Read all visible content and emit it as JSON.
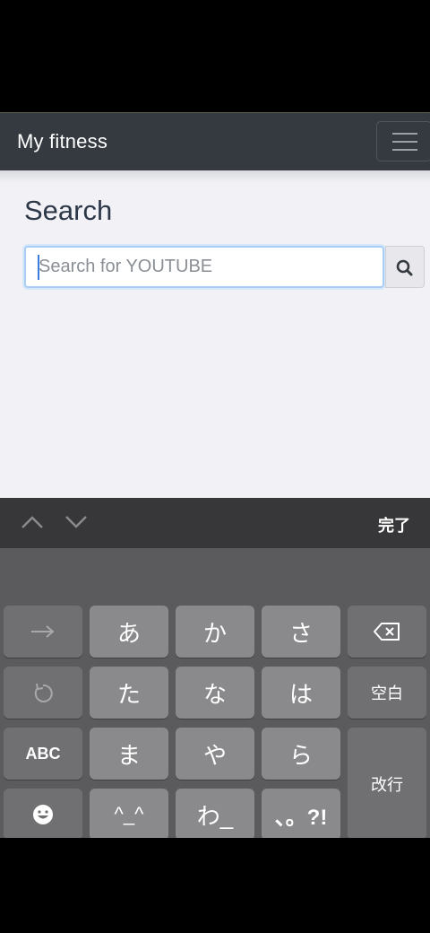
{
  "navbar": {
    "brand": "My fitness",
    "menu_icon": "hamburger-icon"
  },
  "main": {
    "title": "Search",
    "search": {
      "placeholder": "Search for YOUTUBE",
      "value": "",
      "button_icon": "search-icon"
    }
  },
  "keyboard_toolbar": {
    "done_label": "完了",
    "prev_icon": "chevron-up-icon",
    "next_icon": "chevron-down-icon"
  },
  "keyboard": {
    "keys": {
      "a": "あ",
      "ka": "か",
      "sa": "さ",
      "ta": "た",
      "na": "な",
      "ha": "は",
      "ma": "ま",
      "ya": "や",
      "ra": "ら",
      "kaomoji": "^_^",
      "wa": "わ_",
      "punct": "、。?!",
      "space": "空白",
      "abc": "ABC",
      "enter": "改行"
    }
  },
  "colors": {
    "navbar": "#343a40",
    "content_bg": "#f2f2f6",
    "focus": "#a9cdf5",
    "keyboard_bg": "#5b5b5d"
  }
}
